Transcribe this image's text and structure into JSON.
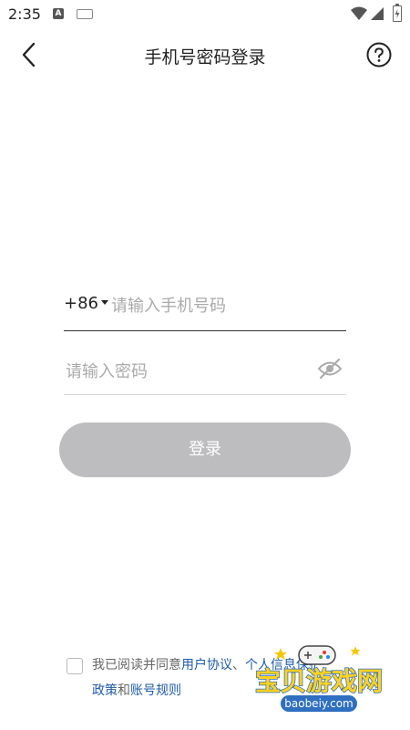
{
  "status_bar": {
    "time": "2:35"
  },
  "header": {
    "title": "手机号密码登录"
  },
  "phone": {
    "country_code": "+86",
    "placeholder": "请输入手机号码"
  },
  "password": {
    "placeholder": "请输入密码"
  },
  "login": {
    "label": "登录"
  },
  "agreement": {
    "prefix": "我已阅读并同意",
    "user_agreement": "用户协议",
    "separator": "、",
    "privacy_part1": "个人信息保护",
    "privacy_part2": "政策",
    "and": "和",
    "account_rules": "账号规则"
  },
  "watermark": {
    "title": "宝贝游戏网",
    "url": "baobeiy.com"
  },
  "colors": {
    "link": "#1e5ba8",
    "button_disabled": "#bdbdbf"
  }
}
